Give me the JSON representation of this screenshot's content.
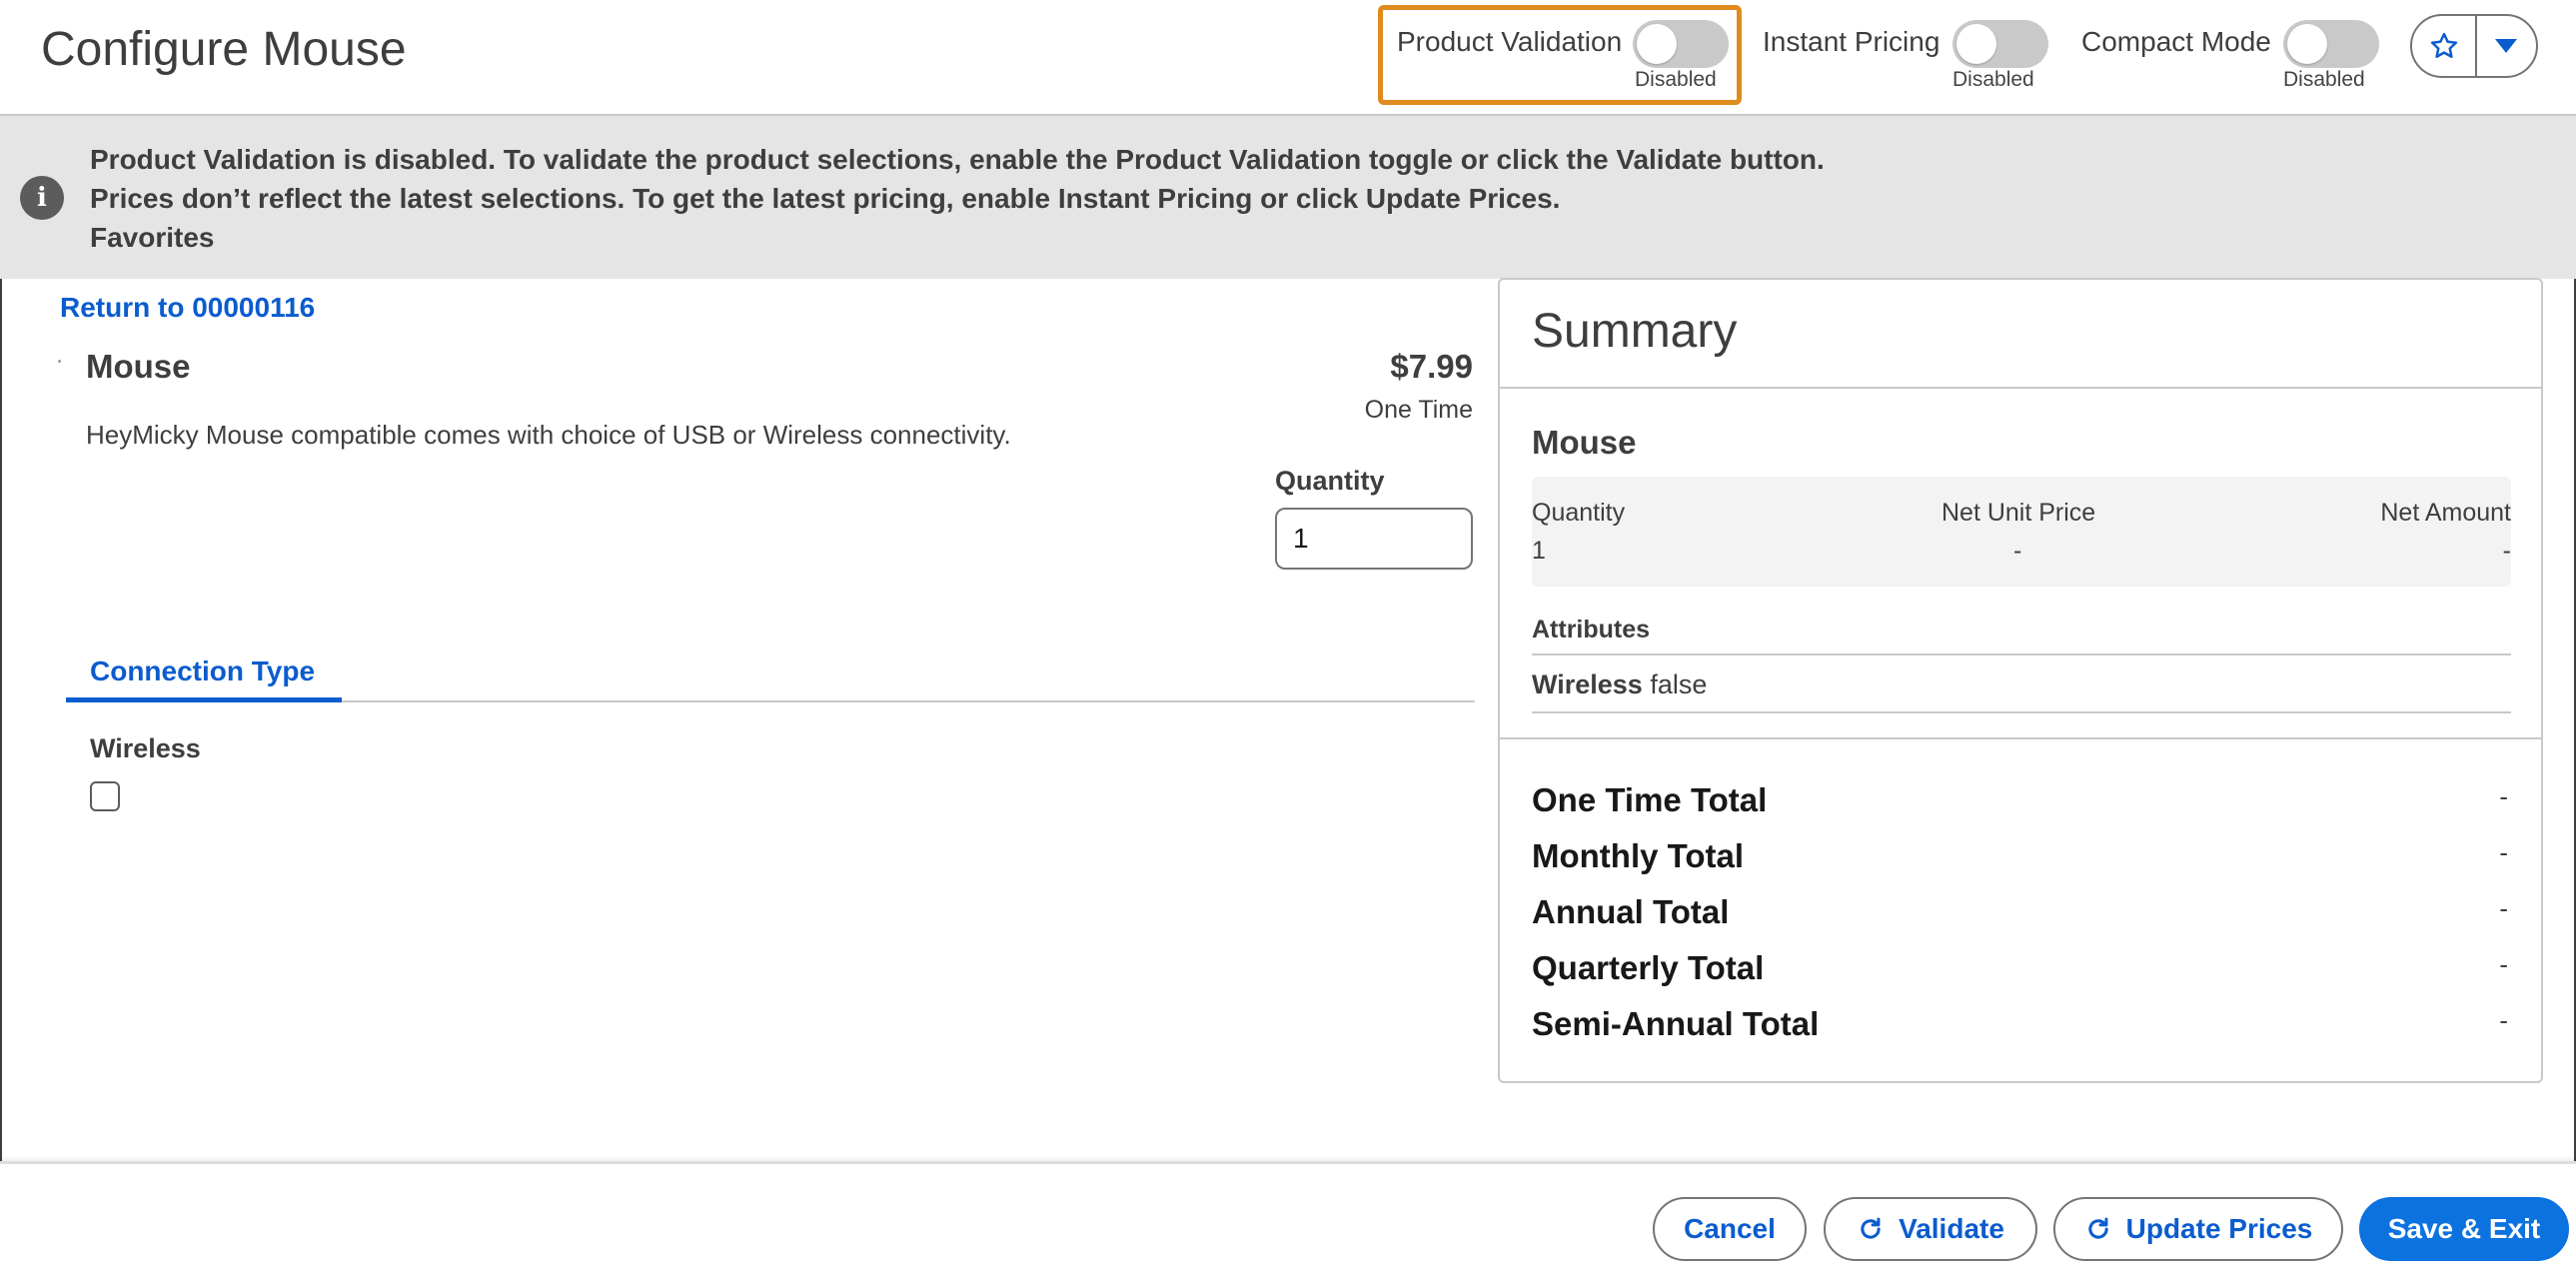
{
  "header": {
    "title": "Configure Mouse",
    "toggles": [
      {
        "label": "Product Validation",
        "status": "Disabled"
      },
      {
        "label": "Instant Pricing",
        "status": "Disabled"
      },
      {
        "label": "Compact Mode",
        "status": "Disabled"
      }
    ],
    "favorites_icon": "star-icon",
    "menu_icon": "chevron-down-icon",
    "highlight_color": "#e08b1e"
  },
  "notice": {
    "icon": "info-icon",
    "line1": "Product Validation is disabled. To validate the product selections, enable the Product Validation toggle or click the Validate button.",
    "line2": "Prices don’t reflect the latest selections. To get the latest pricing, enable Instant Pricing or click Update Prices.",
    "line3": "Favorites"
  },
  "product": {
    "return_link": "Return to 00000116",
    "name": "Mouse",
    "price": "$7.99",
    "frequency": "One Time",
    "description": "HeyMicky Mouse compatible comes with choice of USB or Wireless connectivity.",
    "quantity_label": "Quantity",
    "quantity_value": "1",
    "tab_label": "Connection Type",
    "attribute_label": "Wireless",
    "attribute_checked": false
  },
  "summary": {
    "title": "Summary",
    "product_name": "Mouse",
    "columns": [
      "Quantity",
      "Net Unit Price",
      "Net Amount"
    ],
    "values": [
      "1",
      "-",
      "-"
    ],
    "attributes_heading": "Attributes",
    "attribute_name": "Wireless",
    "attribute_value": "false",
    "totals": [
      {
        "label": "One Time Total",
        "value": "-"
      },
      {
        "label": "Monthly Total",
        "value": "-"
      },
      {
        "label": "Annual Total",
        "value": "-"
      },
      {
        "label": "Quarterly Total",
        "value": "-"
      },
      {
        "label": "Semi-Annual Total",
        "value": "-"
      }
    ]
  },
  "footer": {
    "cancel": "Cancel",
    "validate": "Validate",
    "update_prices": "Update Prices",
    "save_exit": "Save & Exit",
    "refresh_icon": "refresh-icon",
    "brand_color": "#0b72e0"
  }
}
